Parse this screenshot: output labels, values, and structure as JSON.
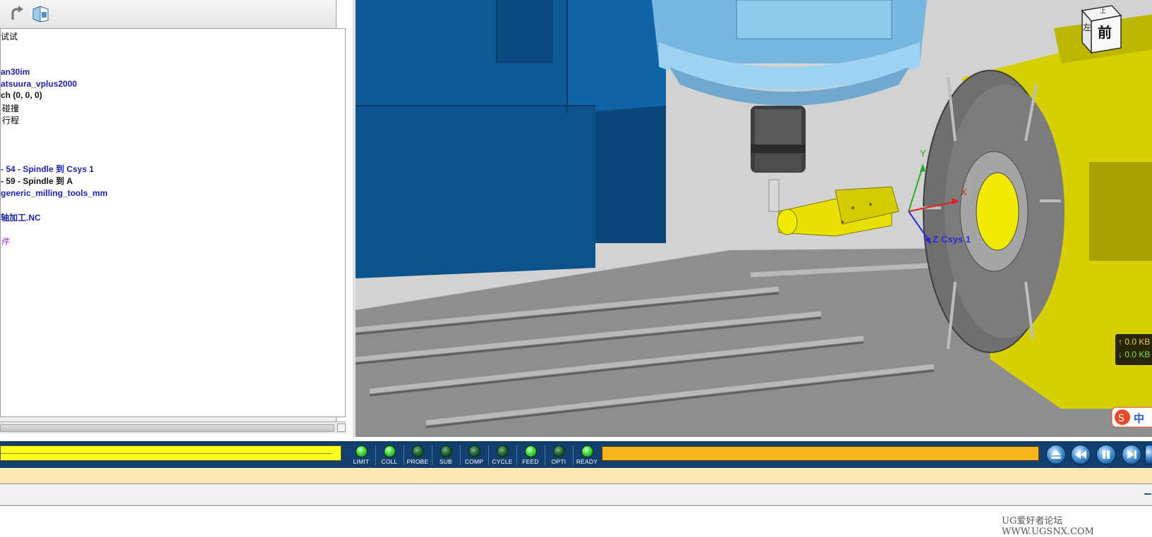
{
  "tree": {
    "items": [
      {
        "text": "试试",
        "style": "normal"
      },
      {
        "text": "an30im",
        "style": "blue"
      },
      {
        "text": "atsuura_vplus2000",
        "style": "blue"
      },
      {
        "text": "ch (0, 0, 0)",
        "style": "bk"
      },
      {
        "text": "碰撞",
        "style": "normal"
      },
      {
        "text": "行程",
        "style": "normal"
      },
      {
        "text": "- 54 - Spindle 到 Csys 1",
        "style": "blue"
      },
      {
        "text": "- 59 - Spindle 到 A",
        "style": "bk"
      },
      {
        "text": "generic_milling_tools_mm",
        "style": "blue"
      },
      {
        "text": "轴加工.NC",
        "style": "blue"
      },
      {
        "text": "件",
        "style": "purple"
      }
    ]
  },
  "viewport": {
    "orientation_cube": {
      "top_label": "上",
      "front_label": "前",
      "left_label": "左"
    },
    "axes": {
      "y_label": "Y",
      "x_label": "X",
      "z_label": "Z",
      "csys_label": "Csys 1"
    },
    "net_meter": {
      "up": "↑ 0.0 KB",
      "down": "↓ 0.0 KB"
    },
    "ime_label": "中"
  },
  "indicators": [
    {
      "label": "LIMIT",
      "on": true
    },
    {
      "label": "COLL",
      "on": true
    },
    {
      "label": "PROBE",
      "on": false
    },
    {
      "label": "SUB",
      "on": false
    },
    {
      "label": "COMP",
      "on": false
    },
    {
      "label": "CYCLE",
      "on": false
    },
    {
      "label": "FEED",
      "on": true
    },
    {
      "label": "OPTI",
      "on": false
    },
    {
      "label": "READY",
      "on": true
    }
  ],
  "playback_buttons": [
    "eject-icon",
    "rewind-icon",
    "pause-icon",
    "step-forward-icon",
    "play-icon"
  ],
  "watermark": "UG爱好者论坛 WWW.UGSNX.COM",
  "colors": {
    "status_bar": "#123f6e",
    "left_progress": "#ffff20",
    "right_progress": "#f7b51d",
    "led_on": "#49e23c",
    "led_off": "#1f5f2e",
    "cmd_line": "#fbe8b4",
    "fixture_blue": "#0b4f86",
    "spindle_light_blue": "#8ed0f0",
    "rotary_yellow": "#e2e200",
    "table_gray": "#8c8c8c"
  }
}
